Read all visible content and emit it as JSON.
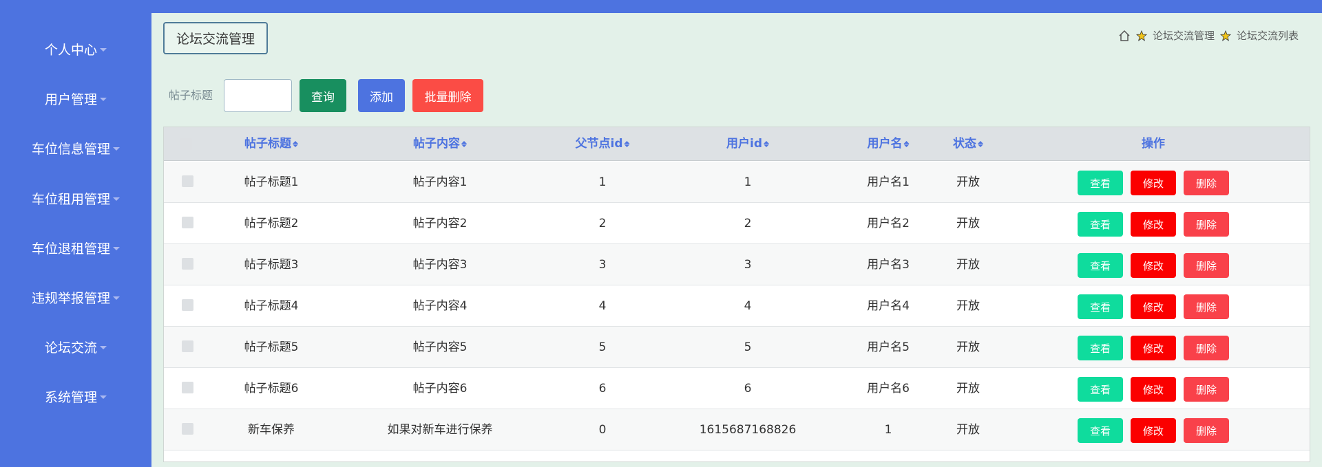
{
  "sidebar": {
    "items": [
      {
        "label": "个人中心"
      },
      {
        "label": "用户管理"
      },
      {
        "label": "车位信息管理"
      },
      {
        "label": "车位租用管理"
      },
      {
        "label": "车位退租管理"
      },
      {
        "label": "违规举报管理"
      },
      {
        "label": "论坛交流"
      },
      {
        "label": "系统管理"
      }
    ]
  },
  "header": {
    "title": "论坛交流管理",
    "breadcrumb": [
      "论坛交流管理",
      "论坛交流列表"
    ]
  },
  "search": {
    "label": "帖子标题",
    "value": "",
    "query_label": "查询",
    "add_label": "添加",
    "batch_delete_label": "批量删除"
  },
  "table": {
    "columns": [
      "帖子标题",
      "帖子内容",
      "父节点id",
      "用户id",
      "用户名",
      "状态",
      "操作"
    ],
    "rows": [
      {
        "title": "帖子标题1",
        "content": "帖子内容1",
        "parentid": "1",
        "userid": "1",
        "username": "用户名1",
        "status": "开放"
      },
      {
        "title": "帖子标题2",
        "content": "帖子内容2",
        "parentid": "2",
        "userid": "2",
        "username": "用户名2",
        "status": "开放"
      },
      {
        "title": "帖子标题3",
        "content": "帖子内容3",
        "parentid": "3",
        "userid": "3",
        "username": "用户名3",
        "status": "开放"
      },
      {
        "title": "帖子标题4",
        "content": "帖子内容4",
        "parentid": "4",
        "userid": "4",
        "username": "用户名4",
        "status": "开放"
      },
      {
        "title": "帖子标题5",
        "content": "帖子内容5",
        "parentid": "5",
        "userid": "5",
        "username": "用户名5",
        "status": "开放"
      },
      {
        "title": "帖子标题6",
        "content": "帖子内容6",
        "parentid": "6",
        "userid": "6",
        "username": "用户名6",
        "status": "开放"
      },
      {
        "title": "新车保养",
        "content": "如果对新车进行保养",
        "parentid": "0",
        "userid": "1615687168826",
        "username": "1",
        "status": "开放"
      }
    ],
    "actions": {
      "view": "查看",
      "edit": "修改",
      "delete": "删除"
    }
  },
  "colors": {
    "primary": "#4d73e0",
    "background": "#e3f1e9",
    "query": "#188f5f",
    "batch_delete": "#fb4c45",
    "view": "#0fdc9d",
    "edit": "#fb0000",
    "delete": "#f9414a"
  }
}
